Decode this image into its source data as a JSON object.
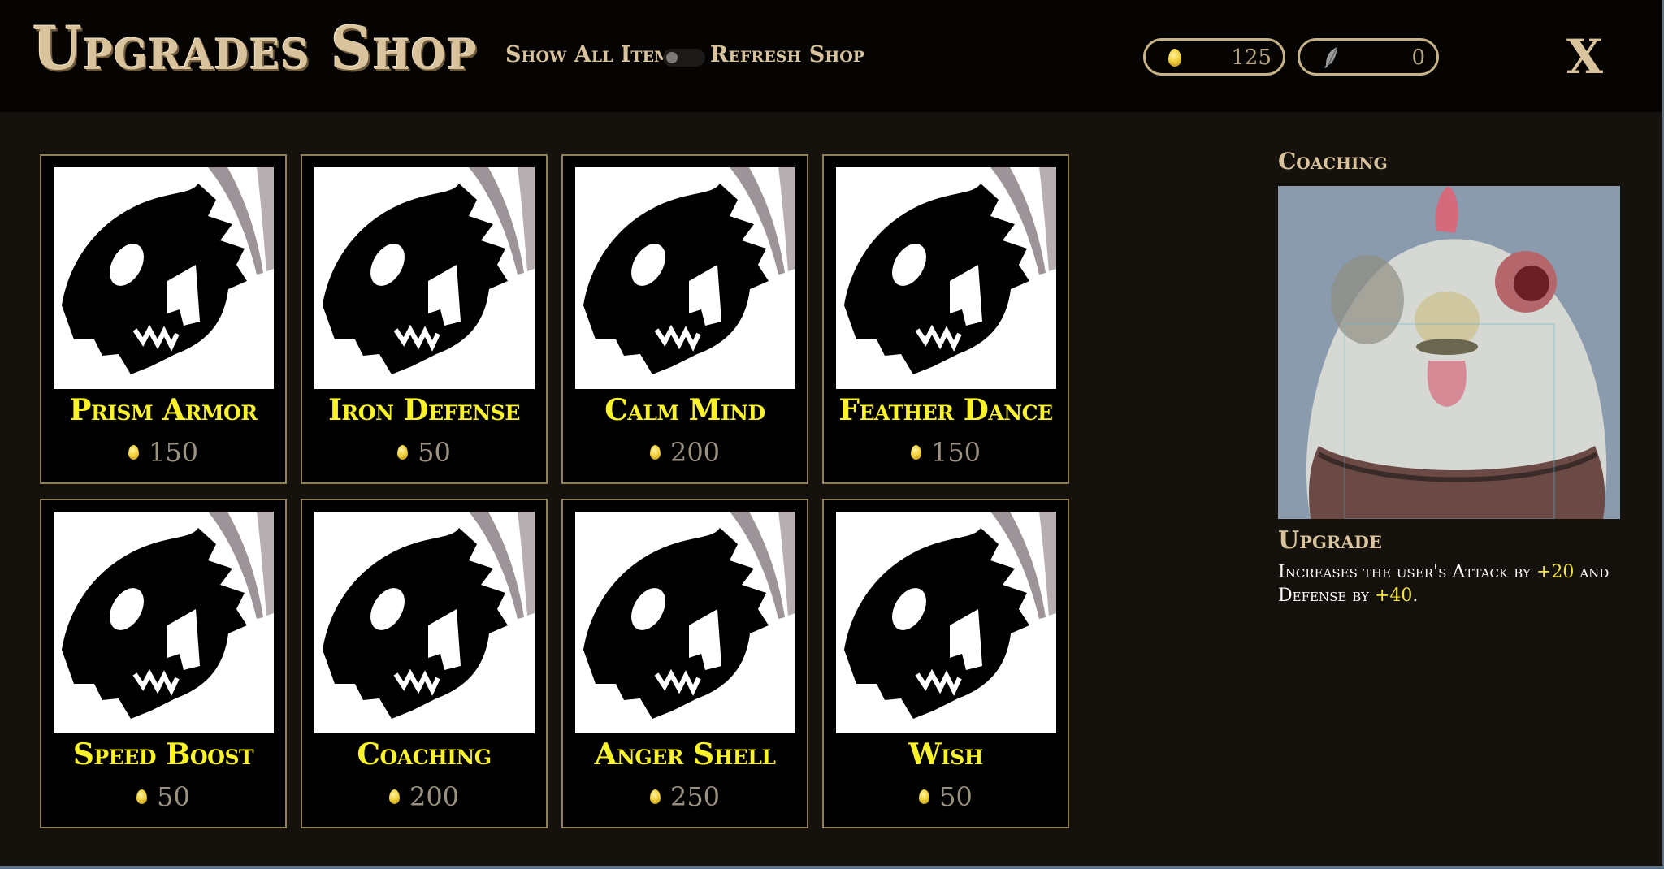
{
  "header": {
    "title": "Upgrades Shop",
    "show_all_label": "Show All Items",
    "show_all_enabled": false,
    "refresh_label": "Refresh Shop",
    "close_label": "X"
  },
  "wallet": {
    "eggs": "125",
    "feathers": "0"
  },
  "items": [
    {
      "name": "Prism Armor",
      "price": "150"
    },
    {
      "name": "Iron Defense",
      "price": "50"
    },
    {
      "name": "Calm Mind",
      "price": "200"
    },
    {
      "name": "Feather Dance",
      "price": "150"
    },
    {
      "name": "Speed Boost",
      "price": "50"
    },
    {
      "name": "Coaching",
      "price": "200"
    },
    {
      "name": "Anger Shell",
      "price": "250"
    },
    {
      "name": "Wish",
      "price": "50"
    }
  ],
  "detail": {
    "title": "Coaching",
    "section_label": "Upgrade",
    "desc_part1": "Increases the user's Attack by ",
    "attack_bonus": "+20",
    "desc_part2": " and Defense by ",
    "defense_bonus": "+40",
    "desc_part3": "."
  },
  "colors": {
    "item_name": "#fbf32a",
    "highlight": "#f5e43a",
    "accent_gold": "#d9c39c"
  }
}
